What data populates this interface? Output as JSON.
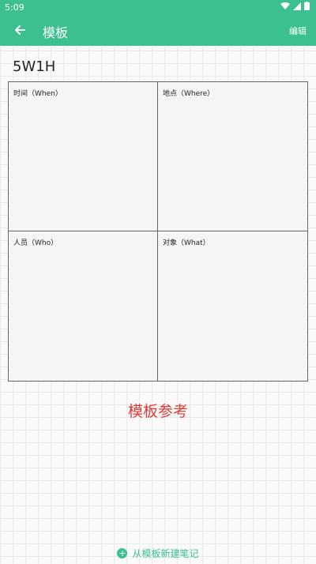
{
  "status_bar": {
    "time": "5:09"
  },
  "app_bar": {
    "title": "模板",
    "edit_label": "编辑"
  },
  "template": {
    "name": "5W1H",
    "cells": [
      {
        "label": "时间（When）"
      },
      {
        "label": "地点（Where）"
      },
      {
        "label": "人员（Who）"
      },
      {
        "label": "对象（What）"
      }
    ]
  },
  "reference_text": "模板参考",
  "bottom_action": {
    "label": "从模板新建笔记",
    "icon": "plus-circle-icon"
  },
  "colors": {
    "accent": "#3cc08f",
    "reference": "#e53935"
  }
}
